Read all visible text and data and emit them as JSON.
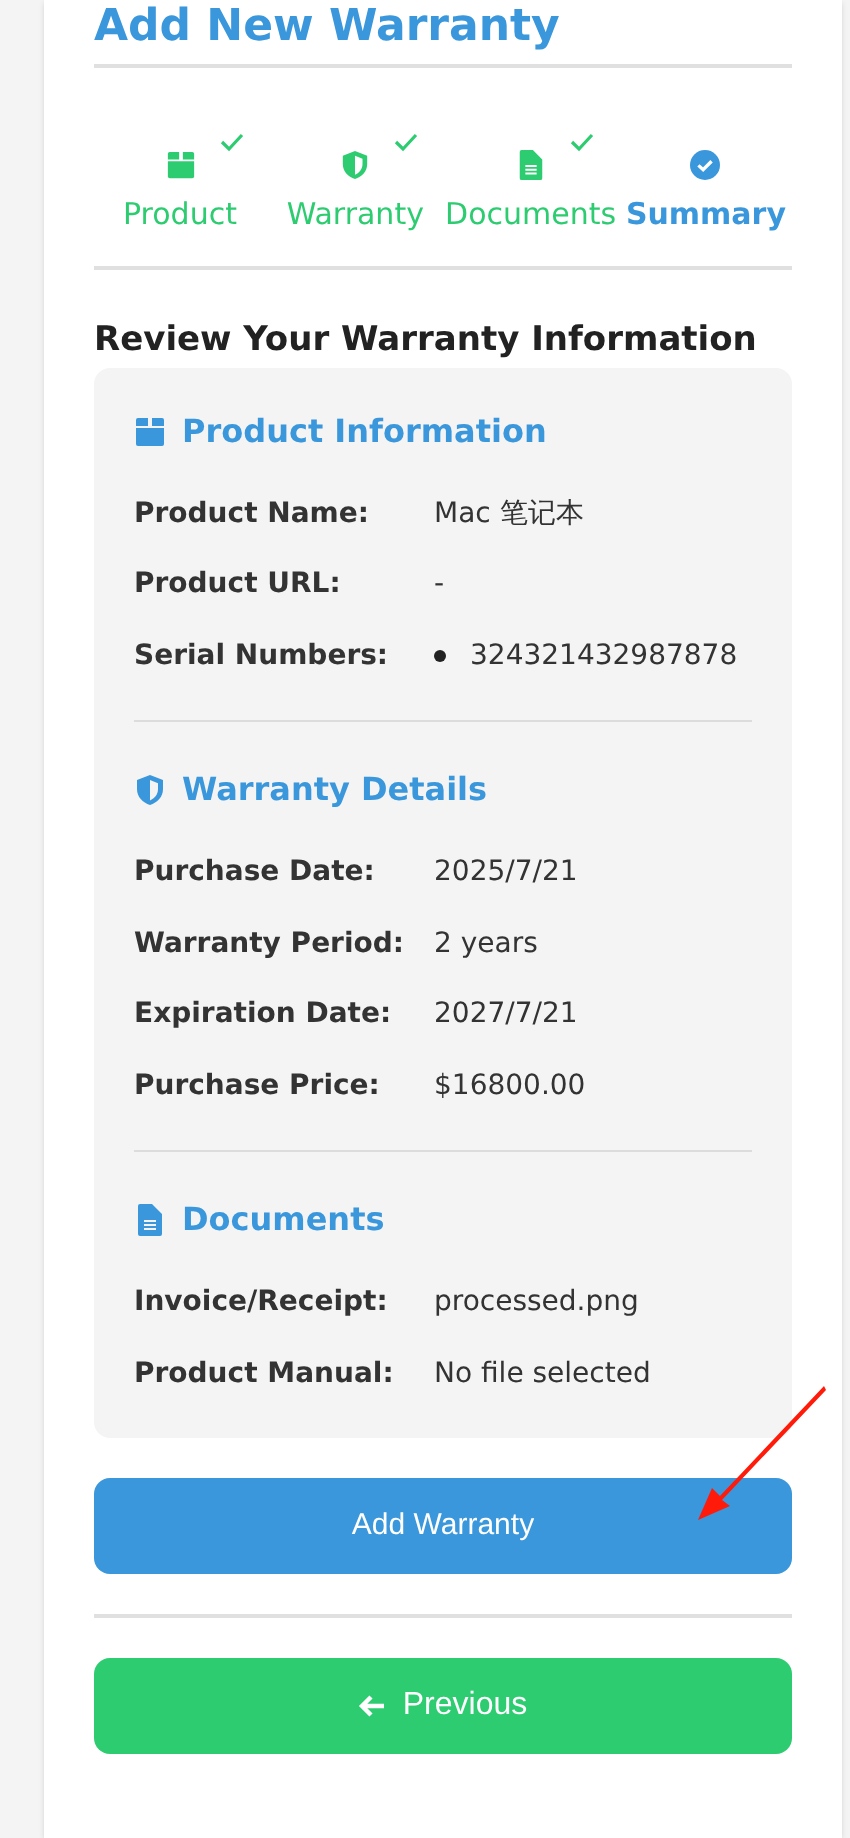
{
  "title": "Add New Warranty",
  "steps": [
    {
      "label": "Product",
      "kind": "box",
      "completed": true,
      "selected": false
    },
    {
      "label": "Warranty",
      "kind": "shield",
      "completed": true,
      "selected": false
    },
    {
      "label": "Documents",
      "kind": "file",
      "completed": true,
      "selected": false
    },
    {
      "label": "Summary",
      "kind": "check",
      "completed": false,
      "selected": true
    }
  ],
  "review_heading": "Review Your Warranty Information",
  "sections": [
    {
      "kind": "box",
      "title": "Product Information",
      "rows": [
        {
          "label": "Product Name:",
          "value": "Mac 笔记本"
        },
        {
          "label": "Product URL:",
          "value": "-"
        },
        {
          "label": "Serial Numbers:",
          "list": [
            "324321432987878"
          ]
        }
      ]
    },
    {
      "kind": "shield",
      "title": "Warranty Details",
      "rows": [
        {
          "label": "Purchase Date:",
          "value": "2025/7/21"
        },
        {
          "label": "Warranty Period:",
          "value": "2 years"
        },
        {
          "label": "Expiration Date:",
          "value": "2027/7/21"
        },
        {
          "label": "Purchase Price:",
          "value": "$16800.00"
        }
      ]
    },
    {
      "kind": "file",
      "title": "Documents",
      "rows": [
        {
          "label": "Invoice/Receipt:",
          "value": "processed.png"
        },
        {
          "label": "Product Manual:",
          "value": "No file selected"
        }
      ]
    }
  ],
  "submit_button": "Add Warranty",
  "previous_button": "Previous"
}
